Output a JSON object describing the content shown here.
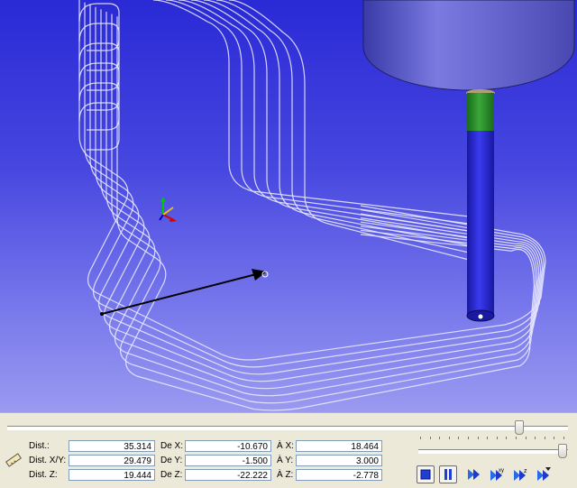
{
  "measure": {
    "dist_label": "Dist.:",
    "dist_value": "35.314",
    "dist_xy_label": "Dist. X/Y:",
    "dist_xy_value": "29.479",
    "dist_z_label": "Dist. Z:",
    "dist_z_value": "19.444",
    "de_x_label": "De X:",
    "de_x_value": "-10.670",
    "de_y_label": "De Y:",
    "de_y_value": "-1.500",
    "de_z_label": "De Z:",
    "de_z_value": "-22.222",
    "a_x_label": "À X:",
    "a_x_value": "18.464",
    "a_y_label": "À Y:",
    "a_y_value": "3.000",
    "a_z_label": "À Z:",
    "a_z_value": "-2.778"
  },
  "playback": {
    "position_fraction": 0.92,
    "speed_fraction": 0.98
  },
  "icons": {
    "ruler": "ruler-icon",
    "stop": "stop-icon",
    "pause": "pause-icon",
    "step": "step-forward-icon",
    "step_xy": "step-forward-xy-icon",
    "step_z": "step-forward-z-icon",
    "step_filter": "step-forward-filter-icon"
  },
  "colors": {
    "background_top": "#2a2ad6",
    "background_bottom": "#9a9af0",
    "toolpath": "#e8e8ff",
    "tool_holder": "#6a6ad8",
    "tool_neck": "#2a8a2a",
    "tool_body": "#2a2ad8"
  }
}
